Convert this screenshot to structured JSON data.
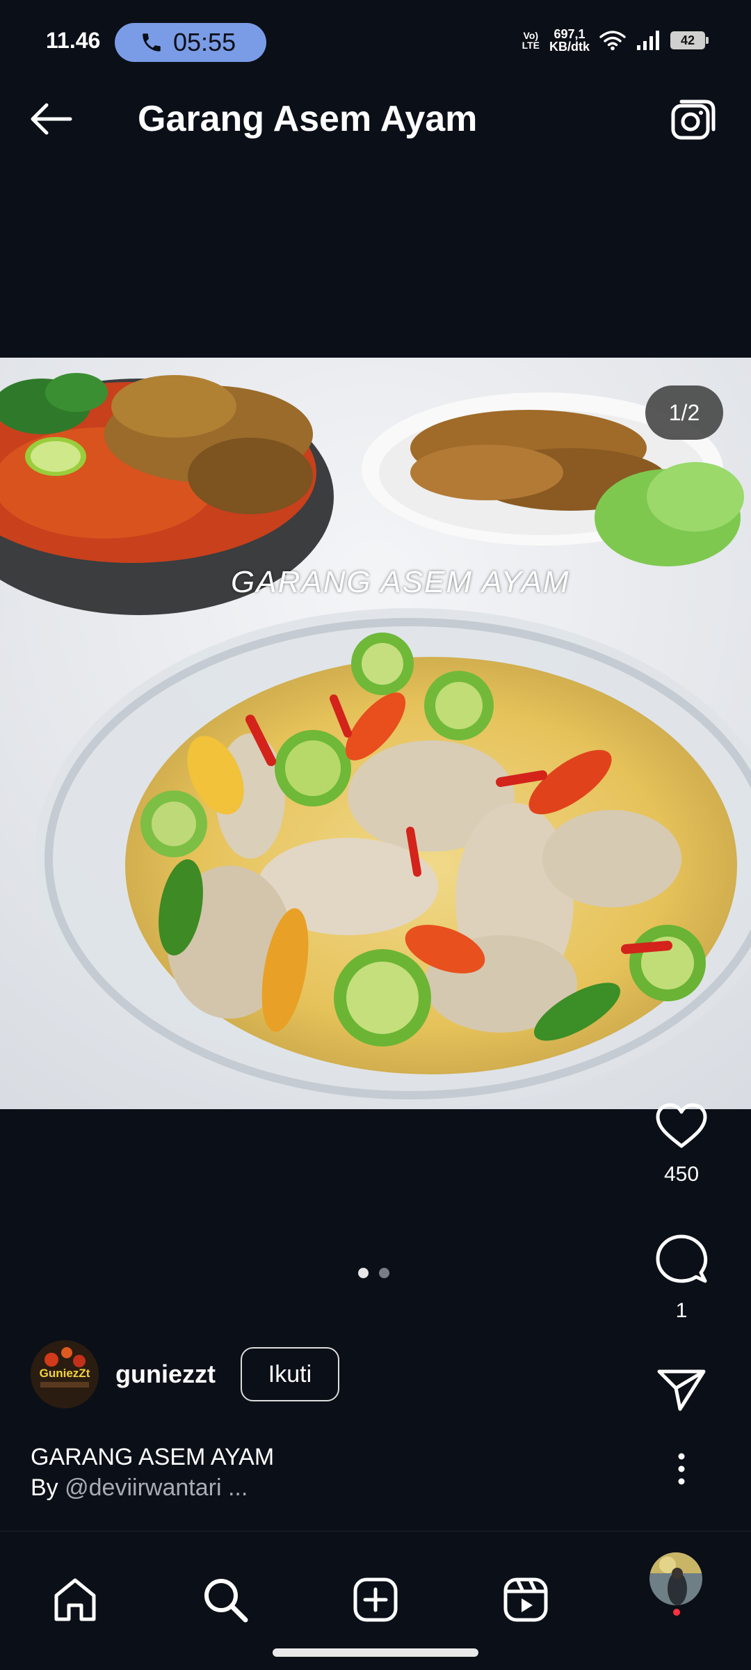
{
  "status_bar": {
    "time": "11.46",
    "call_timer": "05:55",
    "network_badge_top": "Vo)",
    "network_badge_bottom": "LTE",
    "speed_value": "697,1",
    "speed_unit": "KB/dtk",
    "battery": "42"
  },
  "header": {
    "title": "Garang Asem Ayam"
  },
  "post": {
    "image_counter": "1/2",
    "image_overlay_text": "GARANG ASEM AYAM",
    "carousel_total": 2,
    "carousel_index": 1
  },
  "actions": {
    "like_count": "450",
    "comment_count": "1"
  },
  "author": {
    "avatar_label": "GuniezZt",
    "username": "guniezzt",
    "follow_label": "Ikuti"
  },
  "caption": {
    "title": "GARANG ASEM AYAM",
    "by_prefix": "By ",
    "handle": "@deviirwantari",
    "more": " ..."
  },
  "icons": {
    "back": "arrow-left-icon",
    "camera": "camera-icon",
    "like": "heart-icon",
    "comment": "comment-icon",
    "share": "send-icon",
    "more": "more-vertical-icon",
    "home": "home-icon",
    "search": "search-icon",
    "create": "plus-square-icon",
    "reels": "reels-icon"
  },
  "colors": {
    "background": "#0b0f17",
    "call_pill": "#7a9ce6",
    "notification_dot": "#ff3040"
  }
}
